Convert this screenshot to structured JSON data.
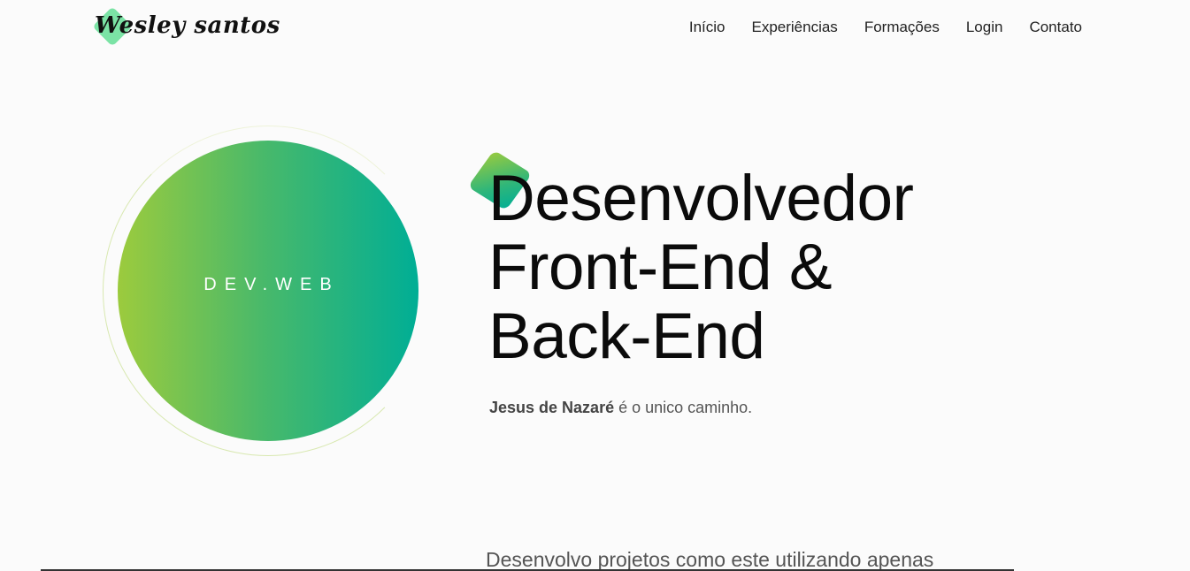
{
  "header": {
    "logo_text": "Wesley santos",
    "nav": [
      {
        "label": "Início"
      },
      {
        "label": "Experiências"
      },
      {
        "label": "Formações"
      },
      {
        "label": "Login"
      },
      {
        "label": "Contato"
      }
    ]
  },
  "hero": {
    "circle_label": "DEV.WEB",
    "title_lines": [
      "Desenvolvedor",
      "Front-End &",
      "Back-End"
    ],
    "tagline_bold": "Jesus de Nazaré",
    "tagline_rest": " é o unico caminho."
  },
  "intro": {
    "text": "Desenvolvo projetos como este utilizando apenas"
  },
  "colors": {
    "gradient_start": "#9ccb3d",
    "gradient_end": "#00ae95",
    "logo_accent": "#7be3a5"
  }
}
